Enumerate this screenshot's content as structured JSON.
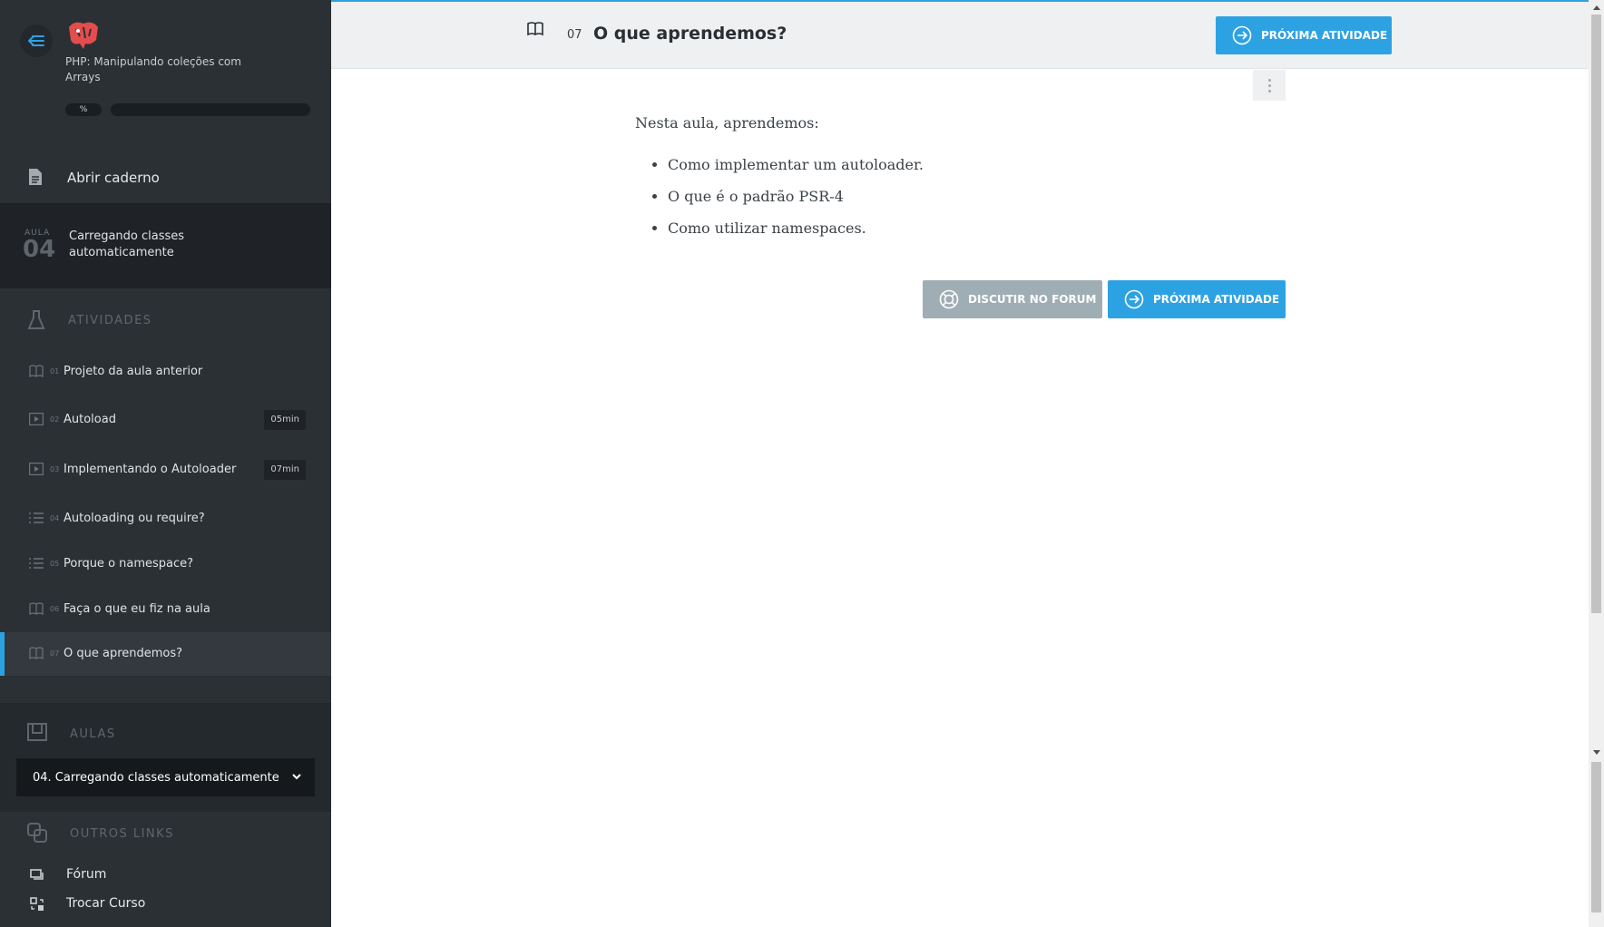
{
  "sidebar": {
    "course_name": "PHP: Manipulando coleções com Arrays",
    "progress_label": "%",
    "progress_fraction": 0,
    "notebook_label": "Abrir caderno",
    "lesson": {
      "label": "AULA",
      "number": "04",
      "title": "Carregando classes automaticamente"
    },
    "activities_title": "ATIVIDADES",
    "activities": [
      {
        "num": "01",
        "label": "Projeto da aula anterior",
        "icon": "book-icon",
        "duration": ""
      },
      {
        "num": "02",
        "label": "Autoload",
        "icon": "video-icon",
        "duration": "05min"
      },
      {
        "num": "03",
        "label": "Implementando o Autoloader",
        "icon": "video-icon",
        "duration": "07min"
      },
      {
        "num": "04",
        "label": "Autoloading ou require?",
        "icon": "list-icon",
        "duration": ""
      },
      {
        "num": "05",
        "label": "Porque o namespace?",
        "icon": "list-icon",
        "duration": ""
      },
      {
        "num": "06",
        "label": "Faça o que eu fiz na aula",
        "icon": "book-icon",
        "duration": ""
      },
      {
        "num": "07",
        "label": "O que aprendemos?",
        "icon": "book-icon",
        "duration": ""
      }
    ],
    "aulas_title": "AULAS",
    "aula_selected": "04. Carregando classes automaticamente",
    "links_title": "OUTROS LINKS",
    "links": [
      {
        "label": "Fórum",
        "icon": "forum-icon"
      },
      {
        "label": "Trocar Curso",
        "icon": "switch-course-icon"
      }
    ]
  },
  "header": {
    "number": "07",
    "title": "O que aprendemos?",
    "next_label": "PRÓXIMA ATIVIDADE"
  },
  "content": {
    "intro": "Nesta aula, aprendemos:",
    "items": [
      "Como implementar um autoloader.",
      "O que é o padrão PSR-4",
      "Como utilizar namespaces."
    ],
    "forum_label": "DISCUTIR NO FORUM",
    "next_label": "PRÓXIMA ATIVIDADE"
  },
  "colors": {
    "accent": "#2da2e3",
    "sidebar_bg": "#2b3035",
    "button_grey": "#9fadb5"
  }
}
